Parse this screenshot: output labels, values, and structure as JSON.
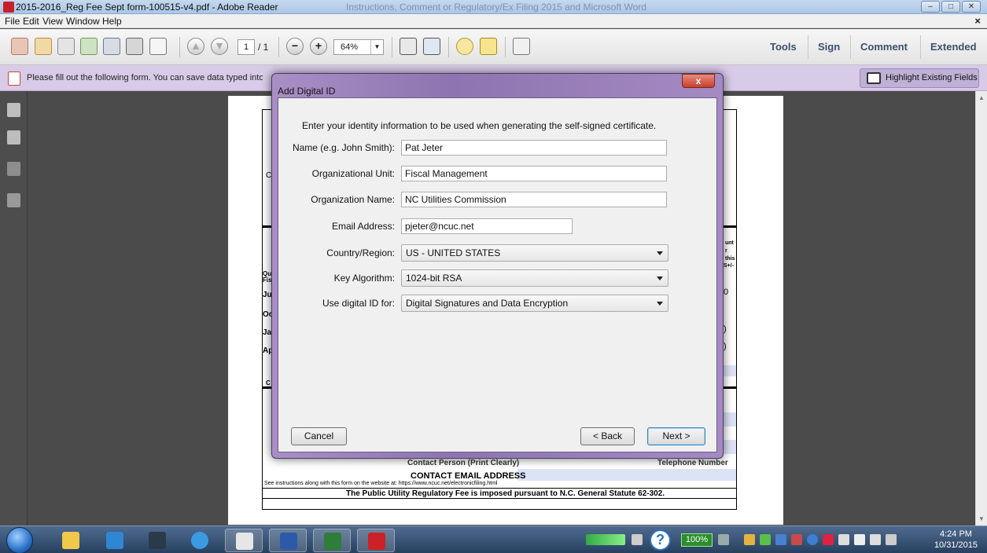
{
  "window": {
    "title": "2015-2016_Reg Fee Sept form-100515-v4.pdf - Adobe Reader",
    "background_title": "Instructions, Comment or Regulatory/Ex Filing 2015 and Microsoft Word"
  },
  "menu": {
    "items": [
      "File",
      "Edit",
      "View",
      "Window",
      "Help"
    ]
  },
  "toolbar": {
    "page_current": "1",
    "page_total": "/ 1",
    "zoom": "64%",
    "links": [
      "Tools",
      "Sign",
      "Comment",
      "Extended"
    ]
  },
  "message_bar": {
    "text": "Please fill out the following form. You can save data typed into this form.",
    "highlight_button": "Highlight Existing Fields"
  },
  "document": {
    "contact_email_label": "CONTACT EMAIL ADDRESS",
    "instructions_line": "See instructions along with this form on the website at: https://www.ncuc.net/electronicfiling.html",
    "statute_line": "The Public Utility Regulatory Fee is imposed pursuant to N.C. General Statute 62-302.",
    "contact_person_label": "Contact Person (Print Clearly)",
    "telephone_label": "Telephone Number",
    "fragments": [
      "C",
      "Qu",
      "Fis",
      "Ju",
      "Oc",
      "Ja",
      "Ap",
      "C",
      "unt",
      "r",
      "this",
      "S+/-",
      "0",
      ")",
      ")"
    ]
  },
  "dialog": {
    "title": "Add Digital ID",
    "close_label": "x",
    "instruction": "Enter your identity information to be used when generating the self-signed certificate.",
    "fields": [
      {
        "label": "Name (e.g. John Smith):",
        "value": "Pat Jeter"
      },
      {
        "label": "Organizational Unit:",
        "value": "Fiscal Management"
      },
      {
        "label": "Organization Name:",
        "value": "NC Utilities Commission"
      },
      {
        "label": "Email Address:",
        "value": "pjeter@ncuc.net"
      }
    ],
    "selects": [
      {
        "label": "Country/Region:",
        "value": "US - UNITED STATES"
      },
      {
        "label": "Key Algorithm:",
        "value": "1024-bit RSA"
      },
      {
        "label": "Use digital ID for:",
        "value": "Digital Signatures and Data Encryption"
      }
    ],
    "buttons": {
      "cancel": "Cancel",
      "back": "< Back",
      "next": "Next >"
    }
  },
  "taskbar": {
    "battery": "100%",
    "help": "?",
    "time": "4:24 PM",
    "date": "10/31/2015"
  },
  "colors": {
    "message_bar": "#d8cbe8",
    "dialog_frame": "#9a80bb",
    "taskbar": "#2f4a6e"
  }
}
